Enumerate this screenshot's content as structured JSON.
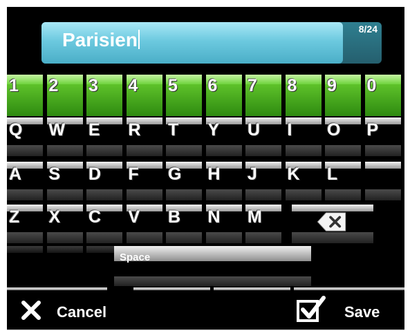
{
  "input": {
    "value": "Parisien",
    "counter": "8/24"
  },
  "keyboard": {
    "number_row": [
      "1",
      "2",
      "3",
      "4",
      "5",
      "6",
      "7",
      "8",
      "9",
      "0"
    ],
    "row1": [
      "Q",
      "W",
      "E",
      "R",
      "T",
      "Y",
      "U",
      "I",
      "O",
      "P"
    ],
    "row2": [
      "A",
      "S",
      "D",
      "F",
      "G",
      "H",
      "J",
      "K",
      "L"
    ],
    "row3": [
      "Z",
      "X",
      "C",
      "V",
      "B",
      "N",
      "M"
    ],
    "space_label": "Space",
    "backspace_icon": "backspace-icon"
  },
  "actions": {
    "cancel_label": "Cancel",
    "cancel_icon": "x-icon",
    "save_label": "Save",
    "save_icon": "checkbox-check-icon"
  },
  "colors": {
    "accent_green": "#5ec22a",
    "field_blue": "#6cc9df"
  }
}
